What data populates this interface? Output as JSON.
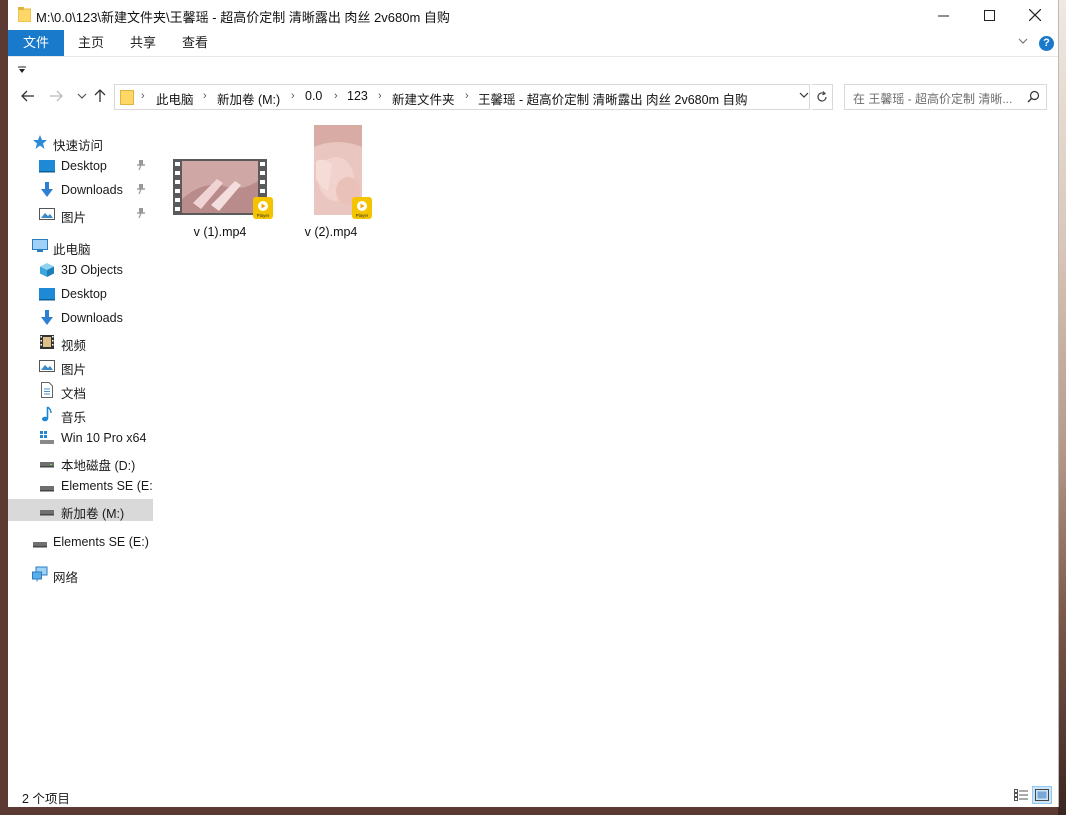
{
  "window": {
    "title": "M:\\0.0\\123\\新建文件夹\\王馨瑶 - 超高价定制 清晰露出 肉丝 2v680m 自购",
    "minimize_icon": "minimize-icon",
    "maximize_icon": "maximize-icon",
    "close_icon": "close-icon"
  },
  "ribbon": {
    "tabs": [
      {
        "label": "文件",
        "active": true
      },
      {
        "label": "主页"
      },
      {
        "label": "共享"
      },
      {
        "label": "查看"
      }
    ],
    "help_label": "?"
  },
  "address": {
    "breadcrumbs": [
      "此电脑",
      "新加卷 (M:)",
      "0.0",
      "123",
      "新建文件夹",
      "王馨瑶 - 超高价定制 清晰露出 肉丝 2v680m 自购"
    ],
    "separator": "›"
  },
  "search": {
    "placeholder": "在 王馨瑶 - 超高价定制 清晰..."
  },
  "sidebar": {
    "items": [
      {
        "label": "快速访问",
        "icon": "star-icon"
      },
      {
        "label": "Desktop",
        "icon": "desktop-icon",
        "pinned": true
      },
      {
        "label": "Downloads",
        "icon": "download-icon",
        "pinned": true
      },
      {
        "label": "图片",
        "icon": "pictures-icon",
        "pinned": true
      },
      {
        "label": "此电脑",
        "icon": "computer-icon"
      },
      {
        "label": "3D Objects",
        "icon": "cube-icon"
      },
      {
        "label": "Desktop",
        "icon": "desktop-icon"
      },
      {
        "label": "Downloads",
        "icon": "download-icon"
      },
      {
        "label": "视频",
        "icon": "video-icon"
      },
      {
        "label": "图片",
        "icon": "pictures-icon"
      },
      {
        "label": "文档",
        "icon": "document-icon"
      },
      {
        "label": "音乐",
        "icon": "music-icon"
      },
      {
        "label": "Win 10 Pro x64",
        "icon": "windows-drive-icon"
      },
      {
        "label": "本地磁盘 (D:)",
        "icon": "drive-icon"
      },
      {
        "label": "Elements SE (E:",
        "icon": "drive-icon"
      },
      {
        "label": "新加卷 (M:)",
        "icon": "drive-icon",
        "selected": true
      },
      {
        "label": "Elements SE (E:)",
        "icon": "drive-icon"
      },
      {
        "label": "网络",
        "icon": "network-icon"
      }
    ]
  },
  "files": [
    {
      "name": "v (1).mp4",
      "badge": "Player"
    },
    {
      "name": "v (2).mp4",
      "badge": "Player"
    }
  ],
  "status": {
    "count_text": "2 个项目"
  },
  "colors": {
    "accent": "#1979ca",
    "selected_bg": "#d9d9d9",
    "folder": "#ffd766",
    "badge": "#f5c400"
  }
}
